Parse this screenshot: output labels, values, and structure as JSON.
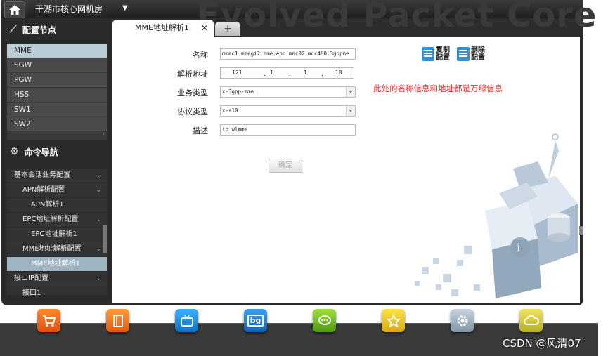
{
  "header": {
    "room_title": "干湖市核心网机房",
    "watermark": "Evolved Packet Core"
  },
  "sidebar": {
    "config_nodes_title": "配置节点",
    "nodes": [
      "MME",
      "SGW",
      "PGW",
      "HSS",
      "SW1",
      "SW2"
    ],
    "active_node": "MME",
    "command_nav_title": "命令导航",
    "tree": [
      {
        "label": "基本会话业务配置",
        "level": 0,
        "expanded": true
      },
      {
        "label": "APN解析配置",
        "level": 1,
        "expanded": true
      },
      {
        "label": "APN解析1",
        "level": 2
      },
      {
        "label": "EPC地址解析配置",
        "level": 1,
        "expanded": true
      },
      {
        "label": "EPC地址解析1",
        "level": 2
      },
      {
        "label": "MME地址解析配置",
        "level": 1,
        "expanded": true
      },
      {
        "label": "MME地址解析1",
        "level": 2,
        "selected": true
      },
      {
        "label": "接口IP配置",
        "level": 0,
        "expanded": true
      },
      {
        "label": "接口1",
        "level": 1
      }
    ]
  },
  "tabs": [
    {
      "label": "MME地址解析1",
      "close": "✕",
      "active": true
    }
  ],
  "tab_add": "+",
  "form": {
    "name_label": "名称",
    "name_value": "mmec1.mmegi2.mme.epc.mnc02.mcc460.3gppne",
    "address_label": "解析地址",
    "address_octets": [
      "121",
      "1",
      "1",
      "10"
    ],
    "service_type_label": "业务类型",
    "service_type_value": "x-3gpp-mme",
    "protocol_type_label": "协议类型",
    "protocol_type_value": "x-s10",
    "desc_label": "描述",
    "desc_value": "to wlmme",
    "confirm_label": "确定"
  },
  "actions": {
    "copy_line1": "复制",
    "copy_line2": "配置",
    "delete_line1": "删除",
    "delete_line2": "配置"
  },
  "note": "此处的名称信息和地址都是万绿信息",
  "dock": {
    "icons": [
      "shop-icon",
      "book-icon",
      "tv-icon",
      "calendar-icon",
      "chat-icon",
      "star-icon",
      "gear-icon",
      "cloud-icon"
    ],
    "calendar_text": "bg"
  },
  "credit": "CSDN @风清07",
  "colors": {
    "accent": "#3a8fd0",
    "note_red": "#e03030",
    "selected_node": "#b9cdd6"
  }
}
